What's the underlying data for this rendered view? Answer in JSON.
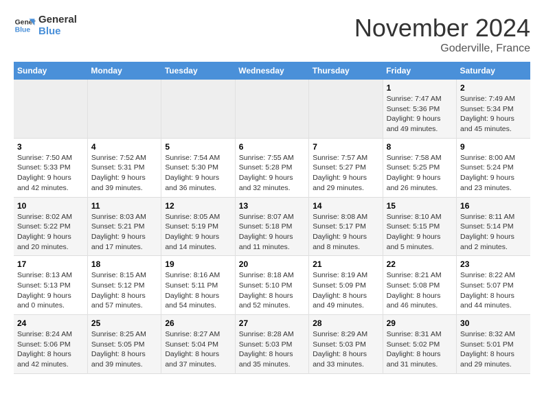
{
  "logo": {
    "line1": "General",
    "line2": "Blue"
  },
  "title": "November 2024",
  "location": "Goderville, France",
  "days_of_week": [
    "Sunday",
    "Monday",
    "Tuesday",
    "Wednesday",
    "Thursday",
    "Friday",
    "Saturday"
  ],
  "weeks": [
    {
      "days": [
        {
          "num": "",
          "info": ""
        },
        {
          "num": "",
          "info": ""
        },
        {
          "num": "",
          "info": ""
        },
        {
          "num": "",
          "info": ""
        },
        {
          "num": "",
          "info": ""
        },
        {
          "num": "1",
          "info": "Sunrise: 7:47 AM\nSunset: 5:36 PM\nDaylight: 9 hours\nand 49 minutes."
        },
        {
          "num": "2",
          "info": "Sunrise: 7:49 AM\nSunset: 5:34 PM\nDaylight: 9 hours\nand 45 minutes."
        }
      ]
    },
    {
      "days": [
        {
          "num": "3",
          "info": "Sunrise: 7:50 AM\nSunset: 5:33 PM\nDaylight: 9 hours\nand 42 minutes."
        },
        {
          "num": "4",
          "info": "Sunrise: 7:52 AM\nSunset: 5:31 PM\nDaylight: 9 hours\nand 39 minutes."
        },
        {
          "num": "5",
          "info": "Sunrise: 7:54 AM\nSunset: 5:30 PM\nDaylight: 9 hours\nand 36 minutes."
        },
        {
          "num": "6",
          "info": "Sunrise: 7:55 AM\nSunset: 5:28 PM\nDaylight: 9 hours\nand 32 minutes."
        },
        {
          "num": "7",
          "info": "Sunrise: 7:57 AM\nSunset: 5:27 PM\nDaylight: 9 hours\nand 29 minutes."
        },
        {
          "num": "8",
          "info": "Sunrise: 7:58 AM\nSunset: 5:25 PM\nDaylight: 9 hours\nand 26 minutes."
        },
        {
          "num": "9",
          "info": "Sunrise: 8:00 AM\nSunset: 5:24 PM\nDaylight: 9 hours\nand 23 minutes."
        }
      ]
    },
    {
      "days": [
        {
          "num": "10",
          "info": "Sunrise: 8:02 AM\nSunset: 5:22 PM\nDaylight: 9 hours\nand 20 minutes."
        },
        {
          "num": "11",
          "info": "Sunrise: 8:03 AM\nSunset: 5:21 PM\nDaylight: 9 hours\nand 17 minutes."
        },
        {
          "num": "12",
          "info": "Sunrise: 8:05 AM\nSunset: 5:19 PM\nDaylight: 9 hours\nand 14 minutes."
        },
        {
          "num": "13",
          "info": "Sunrise: 8:07 AM\nSunset: 5:18 PM\nDaylight: 9 hours\nand 11 minutes."
        },
        {
          "num": "14",
          "info": "Sunrise: 8:08 AM\nSunset: 5:17 PM\nDaylight: 9 hours\nand 8 minutes."
        },
        {
          "num": "15",
          "info": "Sunrise: 8:10 AM\nSunset: 5:15 PM\nDaylight: 9 hours\nand 5 minutes."
        },
        {
          "num": "16",
          "info": "Sunrise: 8:11 AM\nSunset: 5:14 PM\nDaylight: 9 hours\nand 2 minutes."
        }
      ]
    },
    {
      "days": [
        {
          "num": "17",
          "info": "Sunrise: 8:13 AM\nSunset: 5:13 PM\nDaylight: 9 hours\nand 0 minutes."
        },
        {
          "num": "18",
          "info": "Sunrise: 8:15 AM\nSunset: 5:12 PM\nDaylight: 8 hours\nand 57 minutes."
        },
        {
          "num": "19",
          "info": "Sunrise: 8:16 AM\nSunset: 5:11 PM\nDaylight: 8 hours\nand 54 minutes."
        },
        {
          "num": "20",
          "info": "Sunrise: 8:18 AM\nSunset: 5:10 PM\nDaylight: 8 hours\nand 52 minutes."
        },
        {
          "num": "21",
          "info": "Sunrise: 8:19 AM\nSunset: 5:09 PM\nDaylight: 8 hours\nand 49 minutes."
        },
        {
          "num": "22",
          "info": "Sunrise: 8:21 AM\nSunset: 5:08 PM\nDaylight: 8 hours\nand 46 minutes."
        },
        {
          "num": "23",
          "info": "Sunrise: 8:22 AM\nSunset: 5:07 PM\nDaylight: 8 hours\nand 44 minutes."
        }
      ]
    },
    {
      "days": [
        {
          "num": "24",
          "info": "Sunrise: 8:24 AM\nSunset: 5:06 PM\nDaylight: 8 hours\nand 42 minutes."
        },
        {
          "num": "25",
          "info": "Sunrise: 8:25 AM\nSunset: 5:05 PM\nDaylight: 8 hours\nand 39 minutes."
        },
        {
          "num": "26",
          "info": "Sunrise: 8:27 AM\nSunset: 5:04 PM\nDaylight: 8 hours\nand 37 minutes."
        },
        {
          "num": "27",
          "info": "Sunrise: 8:28 AM\nSunset: 5:03 PM\nDaylight: 8 hours\nand 35 minutes."
        },
        {
          "num": "28",
          "info": "Sunrise: 8:29 AM\nSunset: 5:03 PM\nDaylight: 8 hours\nand 33 minutes."
        },
        {
          "num": "29",
          "info": "Sunrise: 8:31 AM\nSunset: 5:02 PM\nDaylight: 8 hours\nand 31 minutes."
        },
        {
          "num": "30",
          "info": "Sunrise: 8:32 AM\nSunset: 5:01 PM\nDaylight: 8 hours\nand 29 minutes."
        }
      ]
    }
  ]
}
